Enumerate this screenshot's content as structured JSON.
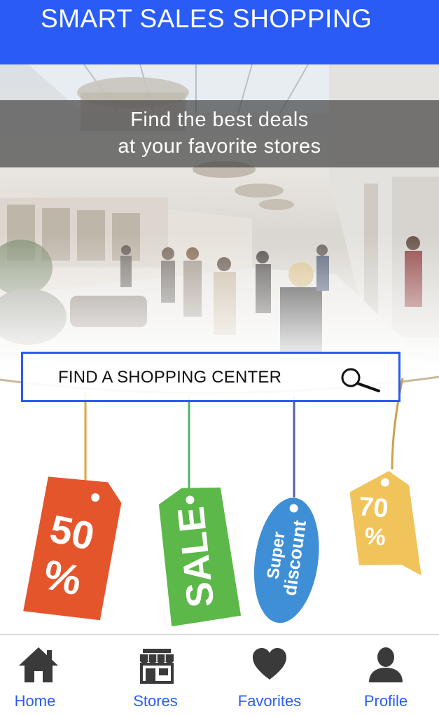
{
  "header": {
    "title": "SMART SALES SHOPPING"
  },
  "hero": {
    "tagline_line1": "Find the best deals",
    "tagline_line2": "at your favorite stores"
  },
  "search": {
    "label": "FIND A SHOPPING CENTER",
    "icon": "search-icon"
  },
  "tags": [
    {
      "text_top": "50",
      "text_bottom": "%",
      "color": "#e5552c"
    },
    {
      "text": "SALE",
      "color": "#5cb848"
    },
    {
      "text_line1": "Super",
      "text_line2": "discount",
      "color": "#3f8fd6"
    },
    {
      "text_top": "70",
      "text_bottom": "%",
      "color": "#f0c45a"
    }
  ],
  "tabbar": {
    "items": [
      {
        "label": "Home",
        "icon": "home-icon"
      },
      {
        "label": "Stores",
        "icon": "store-icon"
      },
      {
        "label": "Favorites",
        "icon": "heart-icon"
      },
      {
        "label": "Profile",
        "icon": "person-icon"
      }
    ]
  },
  "colors": {
    "accent": "#2a5cf5"
  }
}
